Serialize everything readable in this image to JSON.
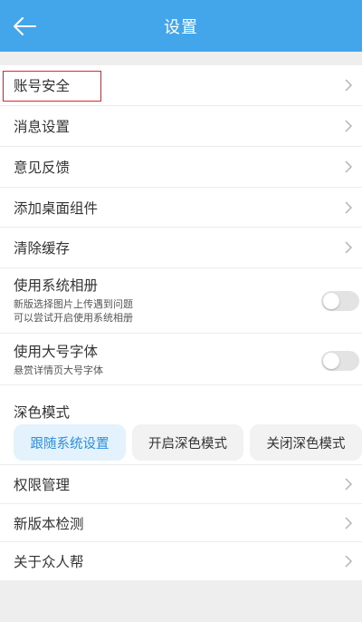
{
  "header": {
    "title": "设置"
  },
  "menu": [
    {
      "label": "账号安全"
    },
    {
      "label": "消息设置"
    },
    {
      "label": "意见反馈"
    },
    {
      "label": "添加桌面组件"
    },
    {
      "label": "清除缓存"
    }
  ],
  "toggles": [
    {
      "title": "使用系统相册",
      "desc_line1": "新版选择图片上传遇到问题",
      "desc_line2": "可以尝试开启使用系统相册",
      "on": false
    },
    {
      "title": "使用大号字体",
      "desc_line1": "悬赏详情页大号字体",
      "on": false
    }
  ],
  "dark_mode": {
    "title": "深色模式",
    "options": [
      "跟随系统设置",
      "开启深色模式",
      "关闭深色模式"
    ],
    "selected": "跟随系统设置"
  },
  "menu2": [
    {
      "label": "权限管理"
    },
    {
      "label": "新版本检测"
    },
    {
      "label": "关于众人帮"
    }
  ],
  "colors": {
    "header": "#44a6ea",
    "selected_bg": "#e3f2fc",
    "selected_text": "#2b8ee0",
    "option_bg": "#f2f2f2",
    "highlight_border": "#e2262d"
  }
}
